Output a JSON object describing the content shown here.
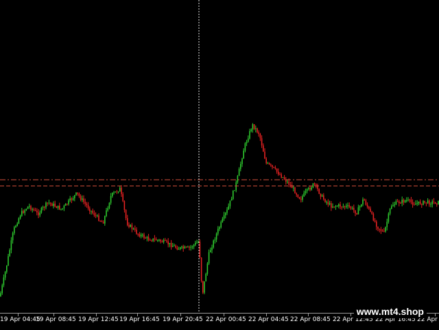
{
  "chart": {
    "background": "#000000",
    "colors": {
      "bull": "#2ec92e",
      "bear": "#e42222",
      "levels": "#d9513c",
      "crosshair": "#e6e6e6"
    },
    "time_labels": [
      "19 Apr 04:45",
      "19 Apr 08:45",
      "19 Apr 12:45",
      "19 Apr 16:45",
      "19 Apr 20:45",
      "22 Apr 00:45",
      "22 Apr 04:45",
      "22 Apr 08:45",
      "22 Apr 12:45",
      "22 Apr 16:45",
      "22 Apr 20:45"
    ],
    "horizontal_levels": 2,
    "vertical_crosshair": true
  },
  "watermark": "www.mt4.shop"
}
